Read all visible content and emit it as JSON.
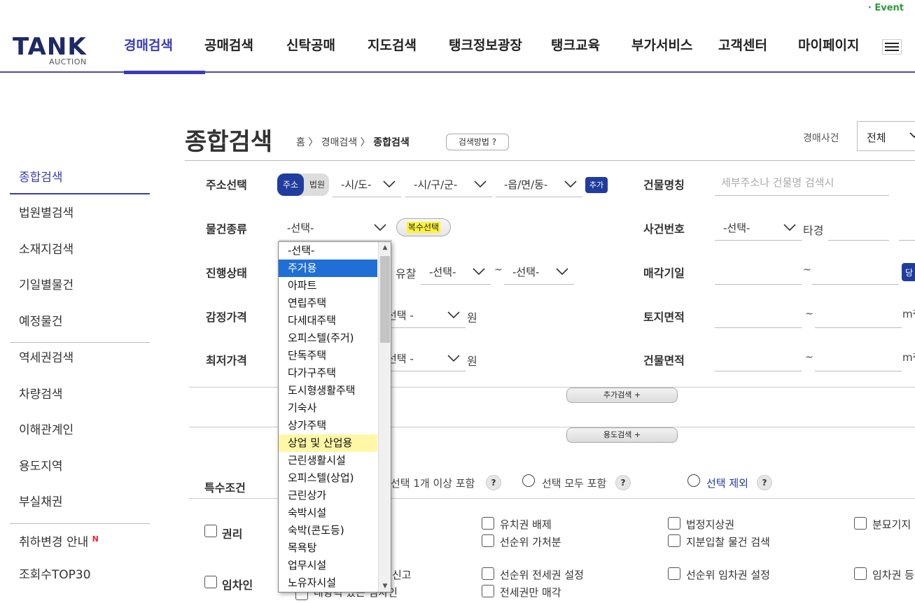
{
  "top_link": "· Event",
  "logo": {
    "word": "TANK",
    "sub": "AUCTION"
  },
  "gnb": [
    {
      "label": "경매검색",
      "active": true
    },
    {
      "label": "공매검색"
    },
    {
      "label": "신탁공매"
    },
    {
      "label": "지도검색"
    },
    {
      "label": "탱크정보광장"
    },
    {
      "label": "탱크교육"
    },
    {
      "label": "부가서비스"
    },
    {
      "label": "고객센터"
    },
    {
      "label": "마이페이지"
    }
  ],
  "lnb": [
    {
      "label": "종합검색",
      "active": true
    },
    {
      "label": "법원별검색"
    },
    {
      "label": "소재지검색"
    },
    {
      "label": "기일별물건"
    },
    {
      "label": "예정물건"
    },
    {
      "label": "역세권검색"
    },
    {
      "label": "차량검색"
    },
    {
      "label": "이해관계인"
    },
    {
      "label": "용도지역"
    },
    {
      "label": "부실채권"
    },
    {
      "label": "취하변경 안내",
      "badge": "N"
    },
    {
      "label": "조회수TOP30"
    }
  ],
  "page": {
    "title": "종합검색",
    "breadcrumb": {
      "home": "홈",
      "sep": "〉",
      "level1": "경매검색",
      "current": "종합검색"
    },
    "howto_button": "검색방법 ?",
    "case_label": "경매사건",
    "case_value": "전체"
  },
  "form": {
    "address_label": "주소선택",
    "toggle_on": "주소",
    "toggle_off": "법원",
    "sido": "-시/도-",
    "sigungu": "-시/구/군-",
    "eupmyeondong": "-읍/면/동-",
    "add_button": "추가",
    "building_label": "건물명칭",
    "building_placeholder": "세부주소나 건물명 검색시",
    "type_label": "물건종류",
    "type_value": "-선택-",
    "multi_button": "복수선택",
    "case_no_label": "사건번호",
    "case_no_value": "-선택-",
    "case_no_suffix": "타경",
    "status_label": "진행상태",
    "failed_label": "유찰",
    "failed_from": "-선택-",
    "tilde": "~",
    "failed_to": "-선택-",
    "sale_date_label": "매각기일",
    "sale_date_tag": "당",
    "appraisal_label": "감정가격",
    "appraisal_value": "선택 -",
    "won": "원",
    "land_area_label": "토지면적",
    "area_unit": "m²",
    "minimum_label": "최저가격",
    "minimum_value": "선택 -",
    "building_area_label": "건물면적",
    "more_search_button": "추가검색 +",
    "usage_search_button": "용도검색 +"
  },
  "special": {
    "label": "특수조건",
    "opt_any": "선택 1개 이상 포함",
    "opt_all": "선택 모두 포함",
    "opt_exclude": "선택 제외",
    "help": "?",
    "rights_label": "권리",
    "tenant_label": "임차인",
    "checkboxes": [
      "유치권 배제",
      "법정지상권",
      "분묘기지",
      "선순위 가처분",
      "지분입찰 물건 검색",
      "선순위 전세권 설정",
      "선순위 임차권 설정",
      "임차권 등",
      "전세권만 매각"
    ],
    "partial_left_1": "신고",
    "partial_left_2": "대항력 있는 임차인"
  },
  "dropdown": {
    "items": [
      "-선택-",
      "주거용",
      "아파트",
      "연립주택",
      "다세대주택",
      "오피스텔(주거)",
      "단독주택",
      "다가구주택",
      "도시형생활주택",
      "기숙사",
      "상가주택",
      "상업 및 산업용",
      "근린생활시설",
      "오피스텔(상업)",
      "근린상가",
      "숙박시설",
      "숙박(콘도등)",
      "목욕탕",
      "업무시설",
      "노유자시설"
    ],
    "selected_index": 1,
    "hover_index": 11
  },
  "colors": {
    "accent": "#3b3bb8",
    "brand_navy": "#1e2a66",
    "button_blue": "#1f3c9e",
    "event_green": "#2e9a3c",
    "highlight": "#fff23c"
  }
}
